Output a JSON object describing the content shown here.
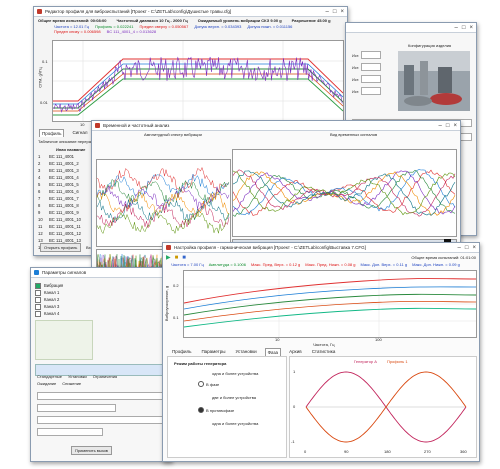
{
  "windows": {
    "profile_editor": {
      "title": "Редактор профиля для виброиспытаний [Проект - C:\\ZETLab\\config\\Душистые травы.cfg]",
      "header": {
        "total_time": "Общее время испытаний: 00:08:00",
        "freq_range": "Частотный диапазон 10 Гц - 2000 Гц",
        "expected_level": "Ожидаемый уровень вибрации СКЗ 9.00 g",
        "resolution": "Разрешение 45.00 g"
      },
      "legend_line1": [
        "Частота = 12.01 Гц",
        "Профиль = 0.022241",
        "Предел сверху = 0.050567",
        "Допуск верхн. = 0.034393",
        "Допуск нижн. = 0.011156"
      ],
      "legend_line2": [
        "Предел снизу = 0.006598",
        "BC 111_4001_4 = 0.013628"
      ],
      "ylabel": "СПМ, g²/Гц",
      "xlabel": "Частота, Гц",
      "ytick_top": "0.1",
      "ytick_bottom": "0.01",
      "xticks": [
        "10",
        "100",
        "1000"
      ],
      "tabs": [
        "Профиль",
        "Сигнал",
        "Шум",
        "Журнал",
        "Регулир",
        "Управление"
      ],
      "table_title": "Табличное описание переработки",
      "table_header": "Иная название",
      "channels": [
        "BC 111_4001",
        "BC 111_4001_2",
        "BC 111_4001_3",
        "BC 111_4001_4",
        "BC 111_4001_5",
        "BC 111_4001_6",
        "BC 111_4001_7",
        "BC 111_4001_8",
        "BC 111_4001_9",
        "BC 111_4001_10",
        "BC 111_4001_11",
        "BC 111_4001_12",
        "BC 111_4001_13",
        "BC 111_4001_14"
      ],
      "channel_numbers": [
        "1",
        "2",
        "3",
        "4",
        "5",
        "6",
        "7",
        "8",
        "9",
        "10",
        "11",
        "12",
        "13",
        "14"
      ],
      "bottom_button": "Открыть профиль",
      "bottom_tab": "Вход"
    },
    "right_panel": {
      "title": "Конфигурация изделия",
      "labels": [
        "Ист.",
        "Ист.",
        "Ист.",
        "Ист."
      ]
    },
    "time_window": {
      "title": "Временной и частотный анализ",
      "left_caption": "Амплитудный спектр вибрации",
      "right_caption": "Вид временных сигналов"
    },
    "bottom_left": {
      "title": "Параметры сигналов",
      "rows": [
        "Вибрация",
        "Канал 1",
        "Канал 2",
        "Канал 3",
        "Канал 4"
      ],
      "section": "Стандартные",
      "columns": [
        "Установки",
        "Ограничения",
        "Ожидание",
        "Снижение"
      ],
      "apply": "Применить вызов"
    },
    "harmonic": {
      "title": "Настройка профиля - гармоническая вибрация [Проект - C:\\ZETLab\\config\\Выставка 7.CFG]",
      "total_time": "Общее время испытаний: 01:01:00",
      "legend": [
        "Частота = 7.00 Гц",
        "Амплитуда = 0.1006",
        "Макс. Пред. Верх. = 0.12 g",
        "Макс. Пред. Нижн. = 0.08 g",
        "Макс. Доп. Верх. = 0.11 g",
        "Макс. Доп. Нижн. = 0.09 g"
      ],
      "ylabel": "Виброускорение, g",
      "xlabel": "Частота, Гц",
      "yticks": [
        "0.2",
        "0.1"
      ],
      "xticks": [
        "10",
        "100"
      ],
      "tabs": [
        "Профиль",
        "Параметры",
        "Установки",
        "Фаза",
        "Архив",
        "Статистика"
      ],
      "active_tab": "Фаза",
      "mode_title": "Режим работы генератора",
      "options": [
        "одна и более устройства",
        "В фазе",
        "две и более устройства",
        "В противофазе",
        "одна и более устройства"
      ],
      "chart_legend": [
        "Генератор А",
        "Профиль 1"
      ],
      "chart_xticks": [
        "0",
        "90",
        "180",
        "270",
        "360"
      ],
      "chart_yticks": [
        "1",
        "0",
        "-1"
      ]
    }
  },
  "colors": {
    "profile": "#2b8a3e",
    "upper_limit": "#e03131",
    "lower_limit": "#2f9e44",
    "signal": "#7b2cbf",
    "tolerance_upper": "#1c7ed6",
    "tolerance_lower": "#d9480f"
  }
}
